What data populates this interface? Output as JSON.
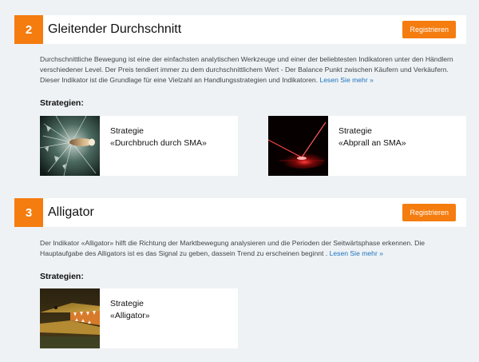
{
  "sections": [
    {
      "number": "2",
      "title": "Gleitender Durchschnitt",
      "register_label": "Registrieren",
      "description": "Durchschnittliche Bewegung ist eine der einfachsten analytischen Werkzeuge und einer der beliebtesten Indikatoren unter den Händlern verschiedener Level. Der Preis tendiert immer zu dem durchschnittlichem Wert - Der Balance Punkt zwischen Käufern und Verkäufern. Dieser Indikator ist die Grundlage für eine Vielzahl an Handlungsstrategien und Indikatoren.",
      "read_more": "Lesen Sie mehr »",
      "strategies_label": "Strategien:",
      "cards": [
        {
          "prefix": "Strategie",
          "name": "«Durchbruch durch SMA»"
        },
        {
          "prefix": "Strategie",
          "name": "«Abprall an SMA»"
        }
      ]
    },
    {
      "number": "3",
      "title": "Alligator",
      "register_label": "Registrieren",
      "description": "Der Indikator «Alligator» hilft die Richtung der Marktbewegung analysieren und die Perioden der Seitwärtsphase erkennen. Die Hauptaufgabe des Alligators ist es das Signal zu geben, dassein Trend zu erscheinen beginnt .",
      "read_more": "Lesen Sie mehr »",
      "strategies_label": "Strategien:",
      "cards": [
        {
          "prefix": "Strategie",
          "name": "«Alligator»"
        }
      ]
    }
  ]
}
